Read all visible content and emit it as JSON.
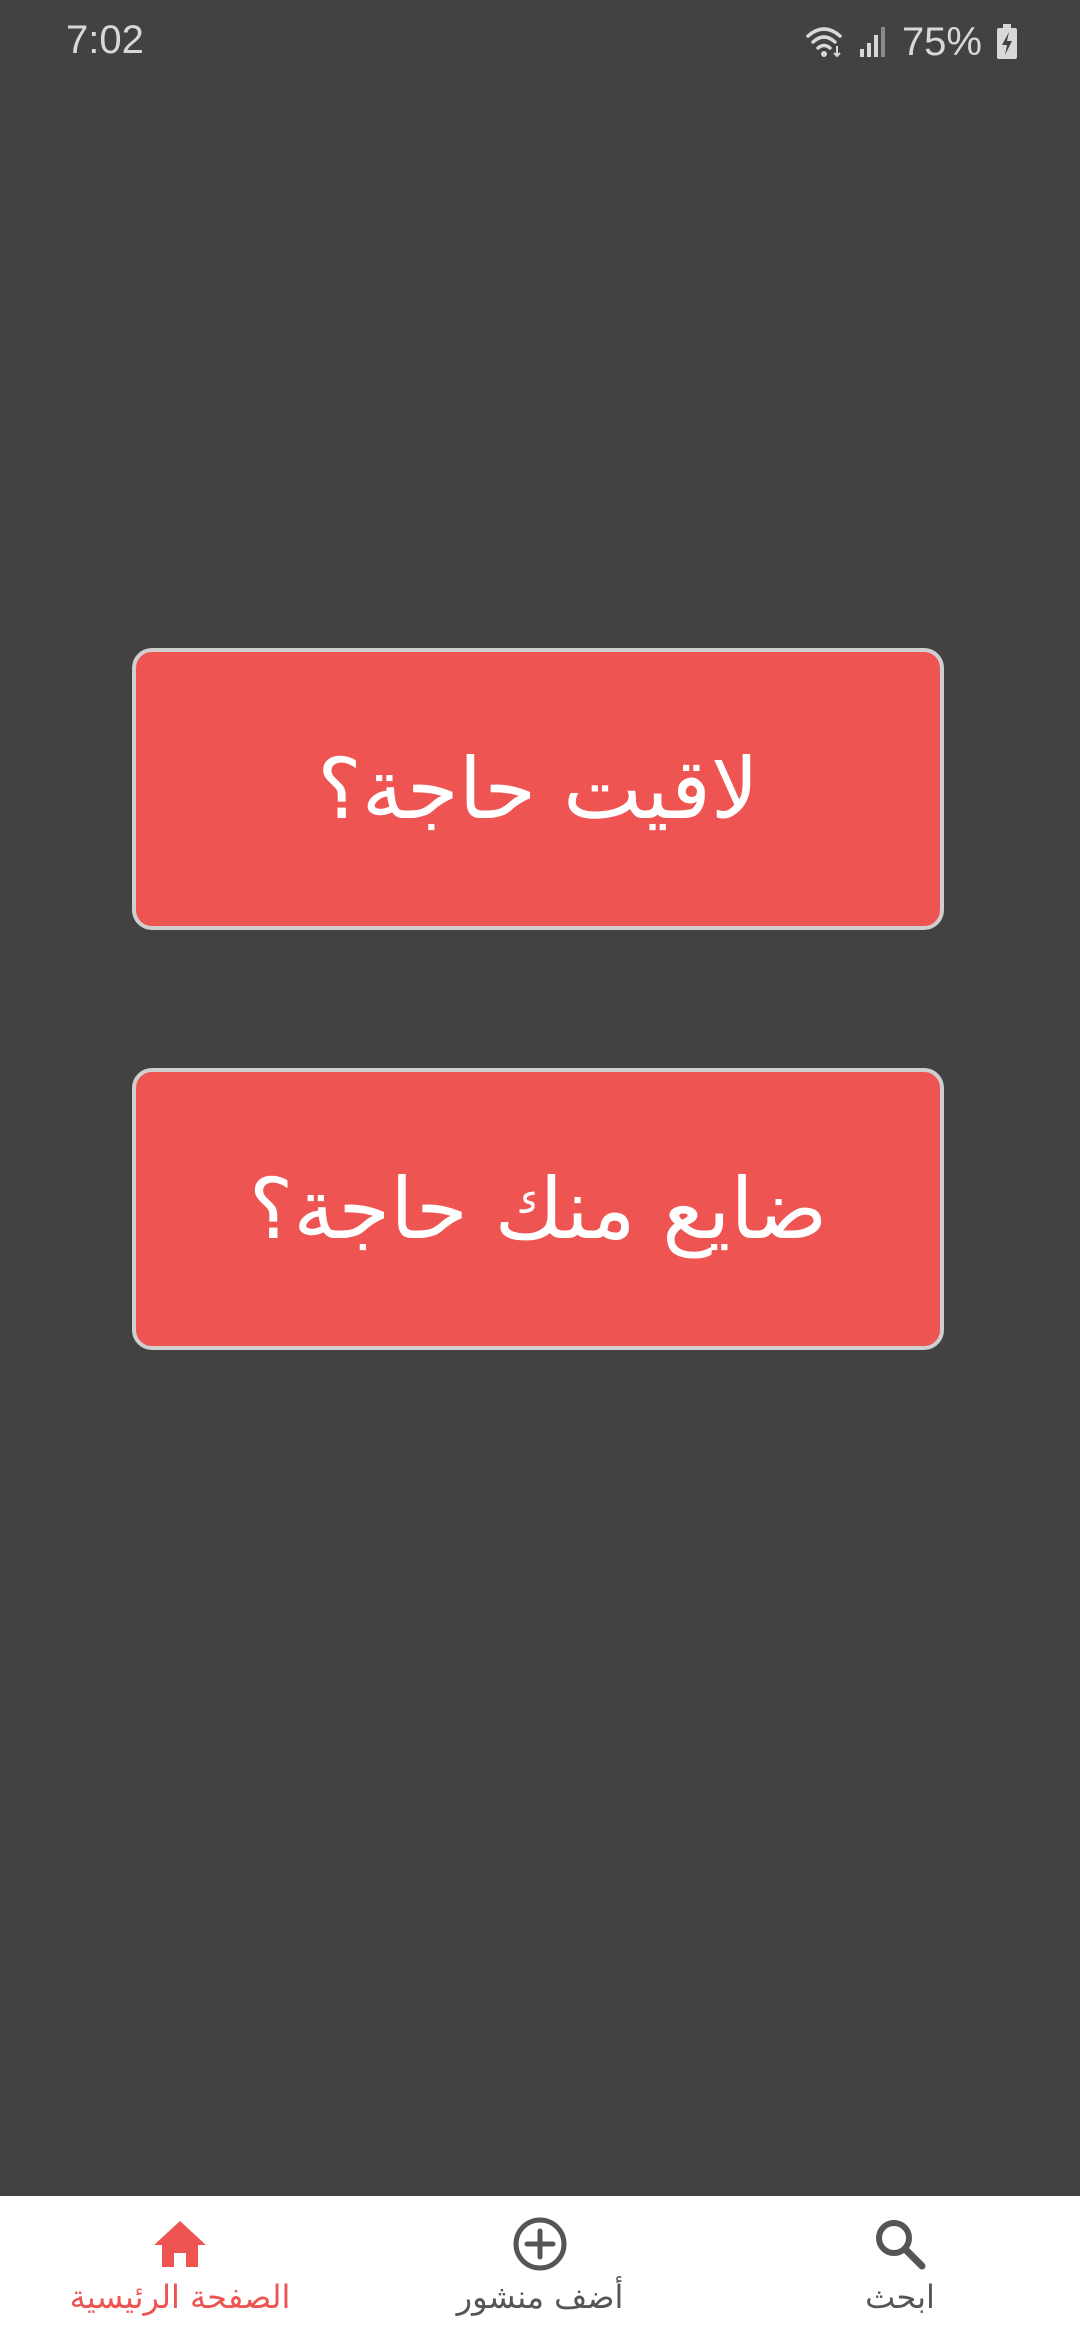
{
  "status_bar": {
    "time": "7:02",
    "battery": "75%",
    "icons": [
      "wifi-icon",
      "signal-icon",
      "battery-charging-icon"
    ]
  },
  "main": {
    "found_button_label": "لاقيت حاجة؟",
    "lost_button_label": "ضايع منك حاجة؟"
  },
  "bottom_nav": {
    "items": [
      {
        "label": "الصفحة الرئيسية",
        "icon": "home-icon",
        "active": true
      },
      {
        "label": "أضف منشور",
        "icon": "add-circle-icon",
        "active": false
      },
      {
        "label": "ابحث",
        "icon": "search-icon",
        "active": false
      }
    ]
  },
  "colors": {
    "background": "#424242",
    "accent": "#ee5452",
    "button_border": "#cfcfcf",
    "nav_background": "#ffffff"
  }
}
